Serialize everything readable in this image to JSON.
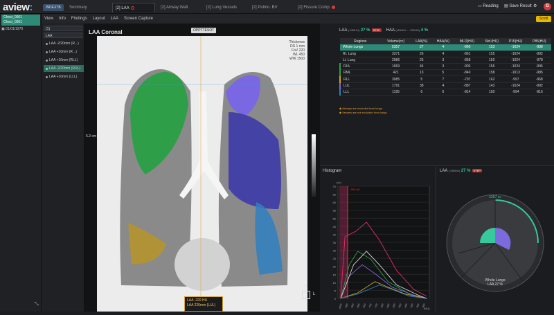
{
  "app": {
    "logo_main": "aview",
    "logo_suffix": ":"
  },
  "topbar": {
    "badge": "INDEXTB",
    "tabs": [
      "Summary",
      "[2] LAA",
      "[2] Airway Wall",
      "[2] Lung Vessels",
      "[2] Pulmo. BV",
      "[2] Fissure Comp."
    ],
    "reading": "Reading",
    "save": "Save Result",
    "user_initial": "G",
    "scroll": "Scroll"
  },
  "patient": {
    "id": "Chest_0001",
    "name": "Chest_0001",
    "study": "01/01/1970"
  },
  "menu": [
    "View",
    "Info",
    "Findings",
    "Layout",
    "LAA",
    "Screen Capture"
  ],
  "panel2": {
    "select1": "(1)",
    "select2": "LAA",
    "series": [
      "LAA -2/20mm (R...)",
      "LAA +10mm (R...)",
      "LAA +10mm (RLL)",
      "LAA -2/20mm (RUL)",
      "LAA +10mm (LLL)"
    ]
  },
  "viewport": {
    "title": "LAA Coronal",
    "center_tag": "OPPTTESOT",
    "info": [
      "Thickness",
      "DS 1 mm",
      "FoV 220",
      "WL 450",
      "WW 1500"
    ],
    "scale": "5.2 cm",
    "bottom_label_1": "LAA -220 HU",
    "bottom_label_2": "LAA 220mm (LUL)",
    "orient_right": "L",
    "orient_foot": "H"
  },
  "summary": {
    "laa_label": "LAA",
    "laa_sub": "(-950HU)",
    "laa_pct": "27 %",
    "laa_tag": "STEP",
    "haa_label": "HAA",
    "haa_sub": "(-800HU ~ -250HU)",
    "haa_pct": "4 %"
  },
  "table": {
    "headers": [
      "Regions",
      "Volume(cc)",
      "LAA(%)",
      "HAA(%)",
      "MLD(HU)",
      "Std.(HU)",
      "P15(HU)",
      "P85(HU)"
    ],
    "rows": [
      [
        "Whole Lungs",
        "5357",
        "27",
        "4",
        "-860",
        "153",
        "-1024",
        "-988"
      ],
      [
        "Rt. Lung",
        "3371",
        "26",
        "4",
        "-861",
        "155",
        "-1024",
        "-992"
      ],
      [
        "Lt. Lung",
        "2986",
        "25",
        "3",
        "-858",
        "150",
        "-1024",
        "-978"
      ],
      [
        "RUL",
        "1669",
        "44",
        "3",
        "-903",
        "156",
        "-1024",
        "-996"
      ],
      [
        "RML",
        "421",
        "13",
        "5",
        "-840",
        "158",
        "-1013",
        "-985"
      ],
      [
        "RLL",
        "3085",
        "5",
        "7",
        "-797",
        "162",
        "-997",
        "-968"
      ],
      [
        "LUL",
        "1791",
        "38",
        "4",
        "-887",
        "143",
        "-1024",
        "-992"
      ],
      [
        "LLL",
        "1195",
        "6",
        "6",
        "-814",
        "150",
        "-994",
        "-916"
      ]
    ],
    "note1": "Airways are excluded from lungs.",
    "note2": "Vessels are not excluded from lungs."
  },
  "histogram": {
    "title": "Histogram",
    "y_unit": "(cc)",
    "x_unit": "(HU)",
    "y_ticks": [
      "70",
      "65",
      "60",
      "55",
      "50",
      "45",
      "40",
      "35",
      "30",
      "25",
      "20",
      "15",
      "10",
      "5",
      "0"
    ],
    "x_ticks": [
      "-1000",
      "-950",
      "-900",
      "-850",
      "-800",
      "-750",
      "-700",
      "-650",
      "-600",
      "-550",
      "-500",
      "-450",
      "-400",
      "-350",
      "-300"
    ],
    "threshold_label": "-950 HU"
  },
  "pie": {
    "title": "LAA",
    "sub": "(-950HU)",
    "pct": "27 %",
    "tag": "STEP",
    "ring_label": "5287 cc",
    "center_label_1": "Whole Lungs",
    "center_label_2": "LAA 27 %"
  },
  "colors": {
    "accent": "#2d8a76",
    "laa_green": "#35c99b",
    "rul": "#2f9e49",
    "lul": "#7c6bdc",
    "lll": "#2f7fc1",
    "rll": "#d1a520",
    "alert": "#b42d2d"
  }
}
